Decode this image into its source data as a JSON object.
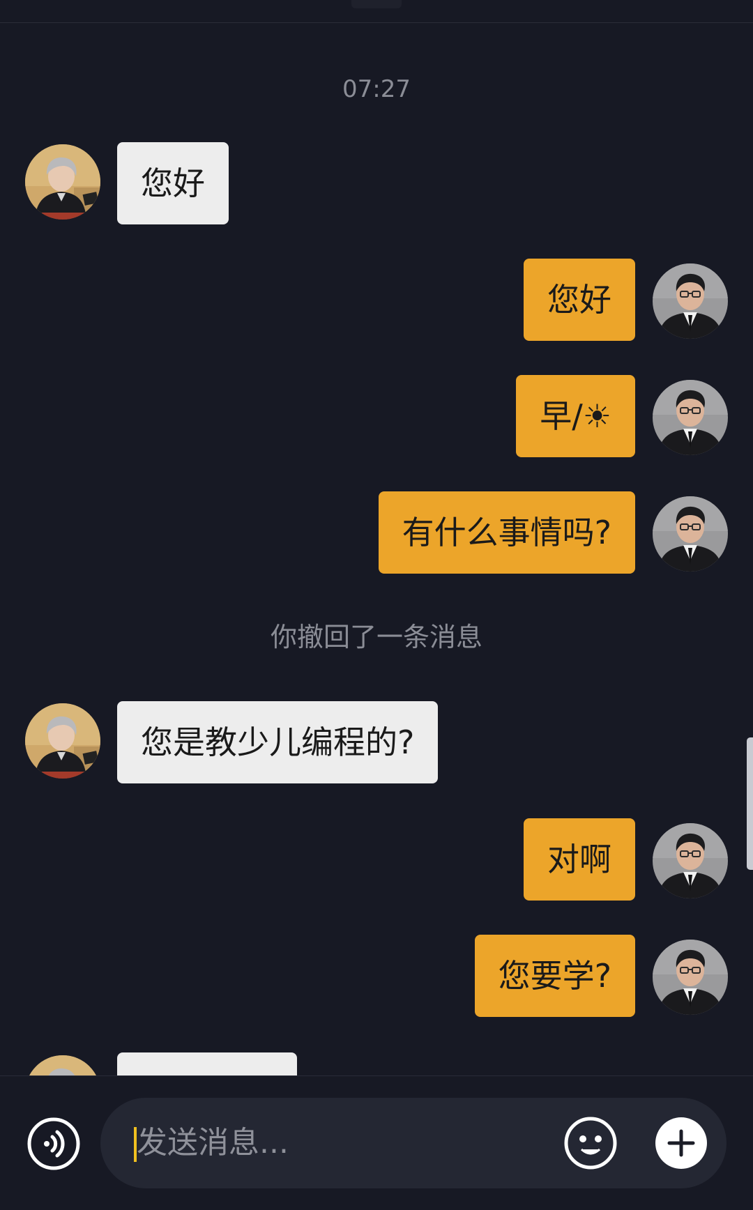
{
  "chat": {
    "timestamp": "07:27",
    "recall_notice": "你撤回了一条消息",
    "messages": [
      {
        "sender": "contact",
        "text": "您好"
      },
      {
        "sender": "me",
        "text": "您好"
      },
      {
        "sender": "me",
        "text": "早/☀"
      },
      {
        "sender": "me",
        "text": "有什么事情吗?"
      },
      {
        "sender": "contact",
        "text": "您是教少儿编程的?"
      },
      {
        "sender": "me",
        "text": "对啊"
      },
      {
        "sender": "me",
        "text": "您要学?"
      }
    ]
  },
  "composer": {
    "placeholder": "发送消息...",
    "voice_icon": "voice-icon",
    "emoji_icon": "emoji-icon",
    "plus_icon": "plus-icon"
  },
  "colors": {
    "background": "#171924",
    "outgoing_bubble": "#eca52a",
    "incoming_bubble": "#ededed",
    "input_background": "#242733",
    "caret": "#f0c020"
  }
}
